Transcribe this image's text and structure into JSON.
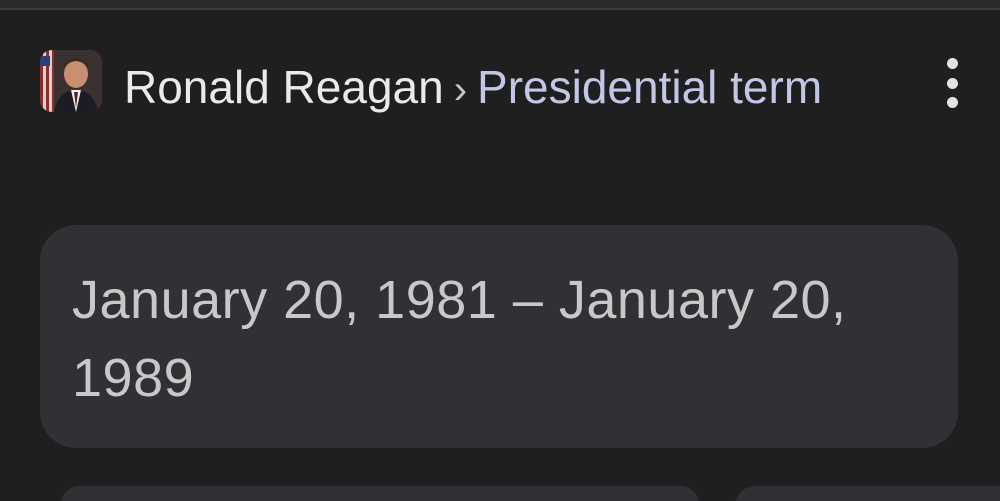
{
  "header": {
    "entity": "Ronald Reagan",
    "separator": "›",
    "attribute": "Presidential term",
    "avatar_icon": "portrait-icon",
    "more_icon": "more-vert-icon"
  },
  "answer": {
    "text": "January 20, 1981 – January 20, 1989"
  },
  "colors": {
    "background": "#1f1f1f",
    "card": "#303134",
    "entity_text": "#e8eaed",
    "attribute_text": "#c2c7e6",
    "answer_text": "#c8c8c8"
  }
}
